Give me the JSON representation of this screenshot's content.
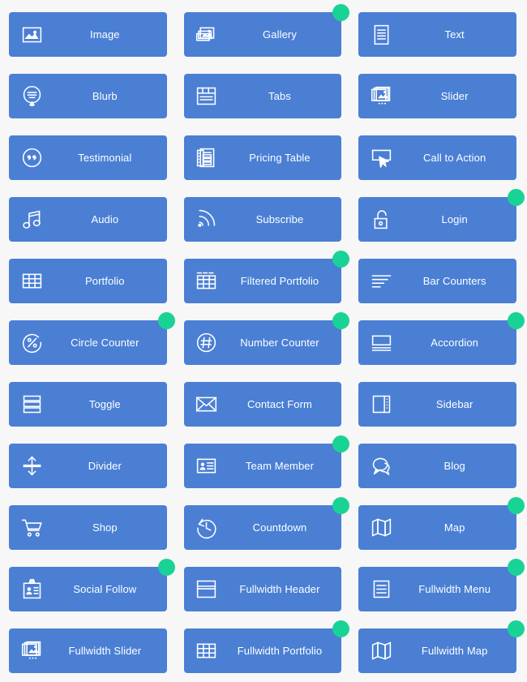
{
  "theme": {
    "page_background": "#f7f7f7",
    "button_color": "#4a7fd4",
    "label_color": "#ffffff",
    "badge_color": "#19d396"
  },
  "modules": [
    {
      "label": "Image",
      "icon": "image-icon",
      "badge": false
    },
    {
      "label": "Gallery",
      "icon": "gallery-icon",
      "badge": true
    },
    {
      "label": "Text",
      "icon": "text-document-icon",
      "badge": false
    },
    {
      "label": "Blurb",
      "icon": "blurb-speech-icon",
      "badge": false
    },
    {
      "label": "Tabs",
      "icon": "tabs-icon",
      "badge": false
    },
    {
      "label": "Slider",
      "icon": "slider-icon",
      "badge": false
    },
    {
      "label": "Testimonial",
      "icon": "quote-circle-icon",
      "badge": false
    },
    {
      "label": "Pricing Table",
      "icon": "pricing-table-icon",
      "badge": false
    },
    {
      "label": "Call to Action",
      "icon": "cursor-click-icon",
      "badge": false
    },
    {
      "label": "Audio",
      "icon": "music-note-icon",
      "badge": false
    },
    {
      "label": "Subscribe",
      "icon": "rss-icon",
      "badge": false
    },
    {
      "label": "Login",
      "icon": "unlock-padlock-icon",
      "badge": true
    },
    {
      "label": "Portfolio",
      "icon": "grid-icon",
      "badge": false
    },
    {
      "label": "Filtered Portfolio",
      "icon": "filtered-grid-icon",
      "badge": true
    },
    {
      "label": "Bar Counters",
      "icon": "bar-counters-icon",
      "badge": false
    },
    {
      "label": "Circle Counter",
      "icon": "percent-circle-icon",
      "badge": true
    },
    {
      "label": "Number Counter",
      "icon": "hash-circle-icon",
      "badge": true
    },
    {
      "label": "Accordion",
      "icon": "accordion-icon",
      "badge": true
    },
    {
      "label": "Toggle",
      "icon": "toggle-rows-icon",
      "badge": false
    },
    {
      "label": "Contact Form",
      "icon": "envelope-icon",
      "badge": false
    },
    {
      "label": "Sidebar",
      "icon": "sidebar-icon",
      "badge": false
    },
    {
      "label": "Divider",
      "icon": "vertical-arrows-icon",
      "badge": false
    },
    {
      "label": "Team Member",
      "icon": "id-card-icon",
      "badge": true
    },
    {
      "label": "Blog",
      "icon": "chat-bubbles-icon",
      "badge": false
    },
    {
      "label": "Shop",
      "icon": "shopping-cart-icon",
      "badge": false
    },
    {
      "label": "Countdown",
      "icon": "clock-rewind-icon",
      "badge": true
    },
    {
      "label": "Map",
      "icon": "folded-map-icon",
      "badge": true
    },
    {
      "label": "Social Follow",
      "icon": "badge-card-icon",
      "badge": true
    },
    {
      "label": "Fullwidth Header",
      "icon": "header-panel-icon",
      "badge": false
    },
    {
      "label": "Fullwidth Menu",
      "icon": "menu-lines-box-icon",
      "badge": true
    },
    {
      "label": "Fullwidth Slider",
      "icon": "slider-icon",
      "badge": false
    },
    {
      "label": "Fullwidth Portfolio",
      "icon": "grid-icon",
      "badge": true
    },
    {
      "label": "Fullwidth Map",
      "icon": "folded-map-icon",
      "badge": true
    }
  ]
}
